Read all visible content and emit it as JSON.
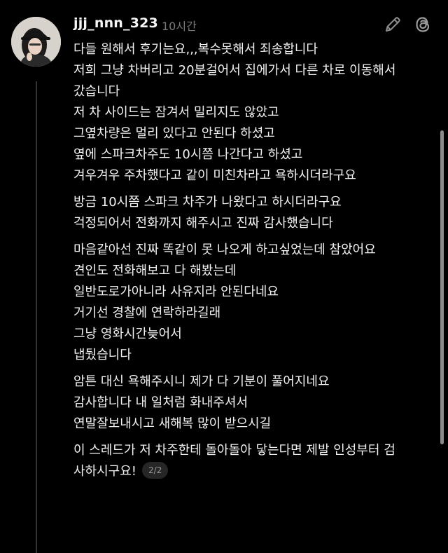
{
  "post": {
    "username": "jjj_nnn_323",
    "timestamp": "10시간",
    "paragraphs": [
      {
        "lines": [
          "다들 원해서 후기는요,,,복수못해서 죄송합니다",
          "저희 그냥 차버리고 20분걸어서 집에가서 다른 차로 이동해서",
          "갔습니다",
          "저 차 사이드는 잠겨서 밀리지도 않았고",
          "그옆차량은 멀리 있다고 안된다 하셨고",
          "옆에 스파크차주도 10시쯤 나간다고 하셨고",
          "겨우겨우 주차했다고 같이 미친차라고 욕하시더라구요"
        ]
      },
      {
        "lines": [
          "방금 10시쯤 스파크 차주가 나왔다고 하시더라구요",
          "걱정되어서 전화까지 해주시고 진짜 감사했습니다"
        ]
      },
      {
        "lines": [
          "마음같아선 진짜 똑같이 못 나오게 하고싶었는데 참았어요",
          "견인도 전화해보고 다 해봤는데",
          "일반도로가아니라 사유지라 안된다네요",
          "거기선 경찰에 연락하라길래",
          "그냥 영화시간늦어서",
          "냅뒀습니다"
        ]
      },
      {
        "lines": [
          "암튼 대신 욕해주시니 제가 다 기분이 풀어지네요",
          "감사합니다 내 일처럼 화내주셔서",
          "연말잘보내시고 새해복 많이 받으시길"
        ]
      },
      {
        "lines": [
          "이 스레드가 저 차주한테 돌아돌아 닿는다면 제발 인성부터 검",
          "사하시구요!"
        ]
      }
    ],
    "page_indicator": "2/2"
  },
  "icons": {
    "edit": "pencil-icon",
    "app": "threads-logo-icon"
  },
  "colors": {
    "background": "#000000",
    "text": "#f2f2f2",
    "muted": "#7a7a7a",
    "badge_bg": "#262626",
    "thread_line": "#333333"
  }
}
